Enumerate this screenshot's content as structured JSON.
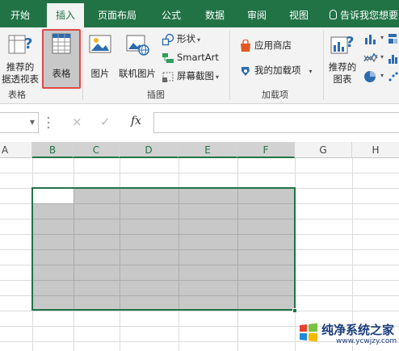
{
  "tabs": [
    {
      "label": "开始",
      "active": false
    },
    {
      "label": "插入",
      "active": true
    },
    {
      "label": "页面布局",
      "active": false
    },
    {
      "label": "公式",
      "active": false
    },
    {
      "label": "数据",
      "active": false
    },
    {
      "label": "审阅",
      "active": false
    },
    {
      "label": "视图",
      "active": false
    }
  ],
  "tell_me": "告诉我您想要",
  "ribbon": {
    "tables": {
      "recommended_pivot_line1": "推荐的",
      "recommended_pivot_line2": "据透视表",
      "table": "表格",
      "group_label": "表格"
    },
    "illustrations": {
      "pictures": "图片",
      "online_pictures": "联机图片",
      "shapes": "形状",
      "smartart": "SmartArt",
      "screenshot": "屏幕截图",
      "group_label": "插图"
    },
    "addins": {
      "store": "应用商店",
      "my_addins": "我的加载项",
      "group_label": "加载项"
    },
    "charts": {
      "recommended_charts_line1": "推荐的",
      "recommended_charts_line2": "图表"
    }
  },
  "formula_bar": {
    "cancel": "×",
    "enter": "✓",
    "fx": "fx",
    "value": ""
  },
  "columns": [
    "A",
    "B",
    "C",
    "D",
    "E",
    "F",
    "G",
    "H"
  ],
  "selected_columns": [
    "B",
    "C",
    "D",
    "E",
    "F"
  ],
  "colors": {
    "accent": "#217346",
    "selection_fill": "#c8c8c8",
    "highlight_box": "#e04848"
  },
  "watermark": {
    "title": "纯净系统之家",
    "url": "www.ycwjzy.com"
  }
}
